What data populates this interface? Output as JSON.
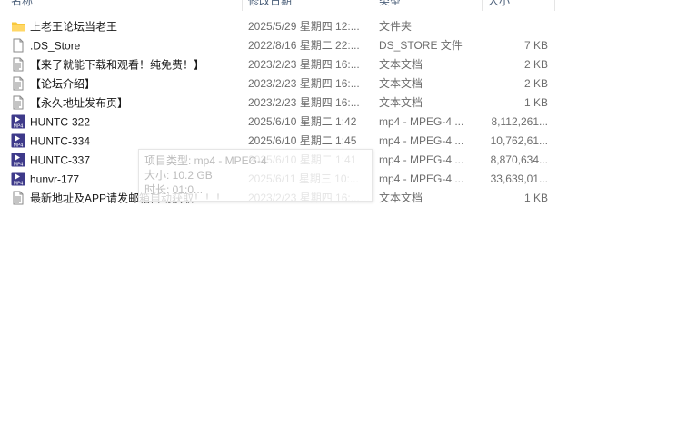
{
  "columns": {
    "name": "名称",
    "date": "修改日期",
    "type": "类型",
    "size": "大小"
  },
  "files": [
    {
      "icon": "folder-icon",
      "name": "上老王论坛当老王",
      "date": "2025/5/29 星期四 12:...",
      "type": "文件夹",
      "size": ""
    },
    {
      "icon": "blank-file-icon",
      "name": ".DS_Store",
      "date": "2022/8/16 星期二 22:...",
      "type": "DS_STORE 文件",
      "size": "7 KB"
    },
    {
      "icon": "text-document-icon",
      "name": "【来了就能下载和观看！纯免费！】",
      "date": "2023/2/23 星期四 16:...",
      "type": "文本文档",
      "size": "2 KB"
    },
    {
      "icon": "text-document-icon",
      "name": "【论坛介绍】",
      "date": "2023/2/23 星期四 16:...",
      "type": "文本文档",
      "size": "2 KB"
    },
    {
      "icon": "text-document-icon",
      "name": "【永久地址发布页】",
      "date": "2023/2/23 星期四 16:...",
      "type": "文本文档",
      "size": "1 KB"
    },
    {
      "icon": "mp4-video-icon",
      "name": "HUNTC-322",
      "date": "2025/6/10 星期二 1:42",
      "type": "mp4 - MPEG-4 ...",
      "size": "8,112,261..."
    },
    {
      "icon": "mp4-video-icon",
      "name": "HUNTC-334",
      "date": "2025/6/10 星期二 1:45",
      "type": "mp4 - MPEG-4 ...",
      "size": "10,762,61..."
    },
    {
      "icon": "mp4-video-icon",
      "name": "HUNTC-337",
      "date": "2025/6/10 星期二 1:41",
      "type": "mp4 - MPEG-4 ...",
      "size": "8,870,634..."
    },
    {
      "icon": "mp4-video-icon",
      "name": "hunvr-177",
      "date": "2025/6/11 星期三 10:...",
      "type": "mp4 - MPEG-4 ...",
      "size": "33,639,01..."
    },
    {
      "icon": "text-document-icon",
      "name": "最新地址及APP请发邮箱自动获取！！！",
      "date": "2023/2/23 星期四 16:...",
      "type": "文本文档",
      "size": "1 KB"
    }
  ],
  "tooltip": {
    "type_line": "项目类型: mp4 - MPEG-4",
    "size_line": "大小: 10.2 GB",
    "length_line": "时长: 01:0..."
  },
  "colors": {
    "folder": "#f8c83c",
    "mp4_bg": "#3e3a8a",
    "header_text": "#4c607a"
  }
}
